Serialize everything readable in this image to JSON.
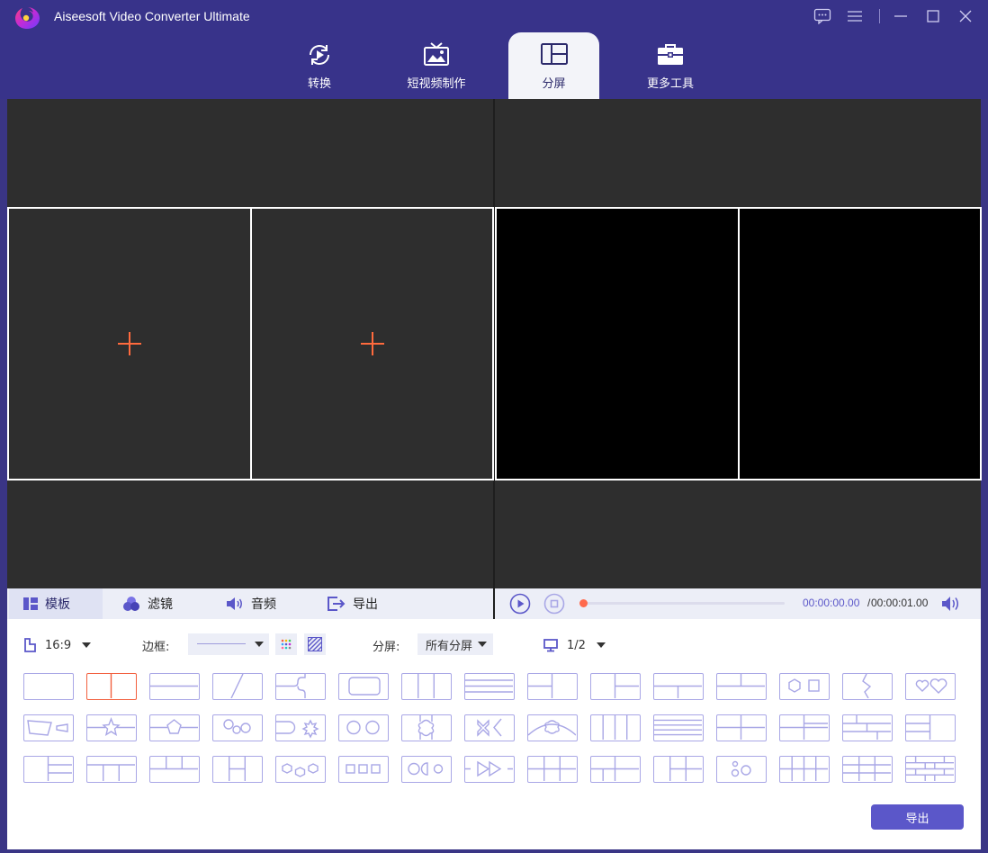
{
  "app": {
    "title": "Aiseesoft Video Converter Ultimate"
  },
  "nav": {
    "tabs": [
      {
        "label": "转换"
      },
      {
        "label": "短视频制作"
      },
      {
        "label": "分屏"
      },
      {
        "label": "更多工具"
      }
    ],
    "active_tab": "分屏"
  },
  "edit_tabs": [
    {
      "label": "模板"
    },
    {
      "label": "滤镜"
    },
    {
      "label": "音频"
    },
    {
      "label": "导出"
    }
  ],
  "player": {
    "time_current": "00:00:00.00",
    "time_separator": "/",
    "time_total": "00:00:01.00",
    "progress": 0
  },
  "options": {
    "aspect_ratio": "16:9",
    "border_label": "边框:",
    "split_label": "分屏:",
    "split_value": "所有分屏",
    "screen_page": "1/2"
  },
  "export_button": "导出",
  "colors": {
    "accent": "#5b57c9",
    "titlebar": "#38338a",
    "highlight": "#f2603f",
    "template_stroke": "#a9a7e6"
  }
}
